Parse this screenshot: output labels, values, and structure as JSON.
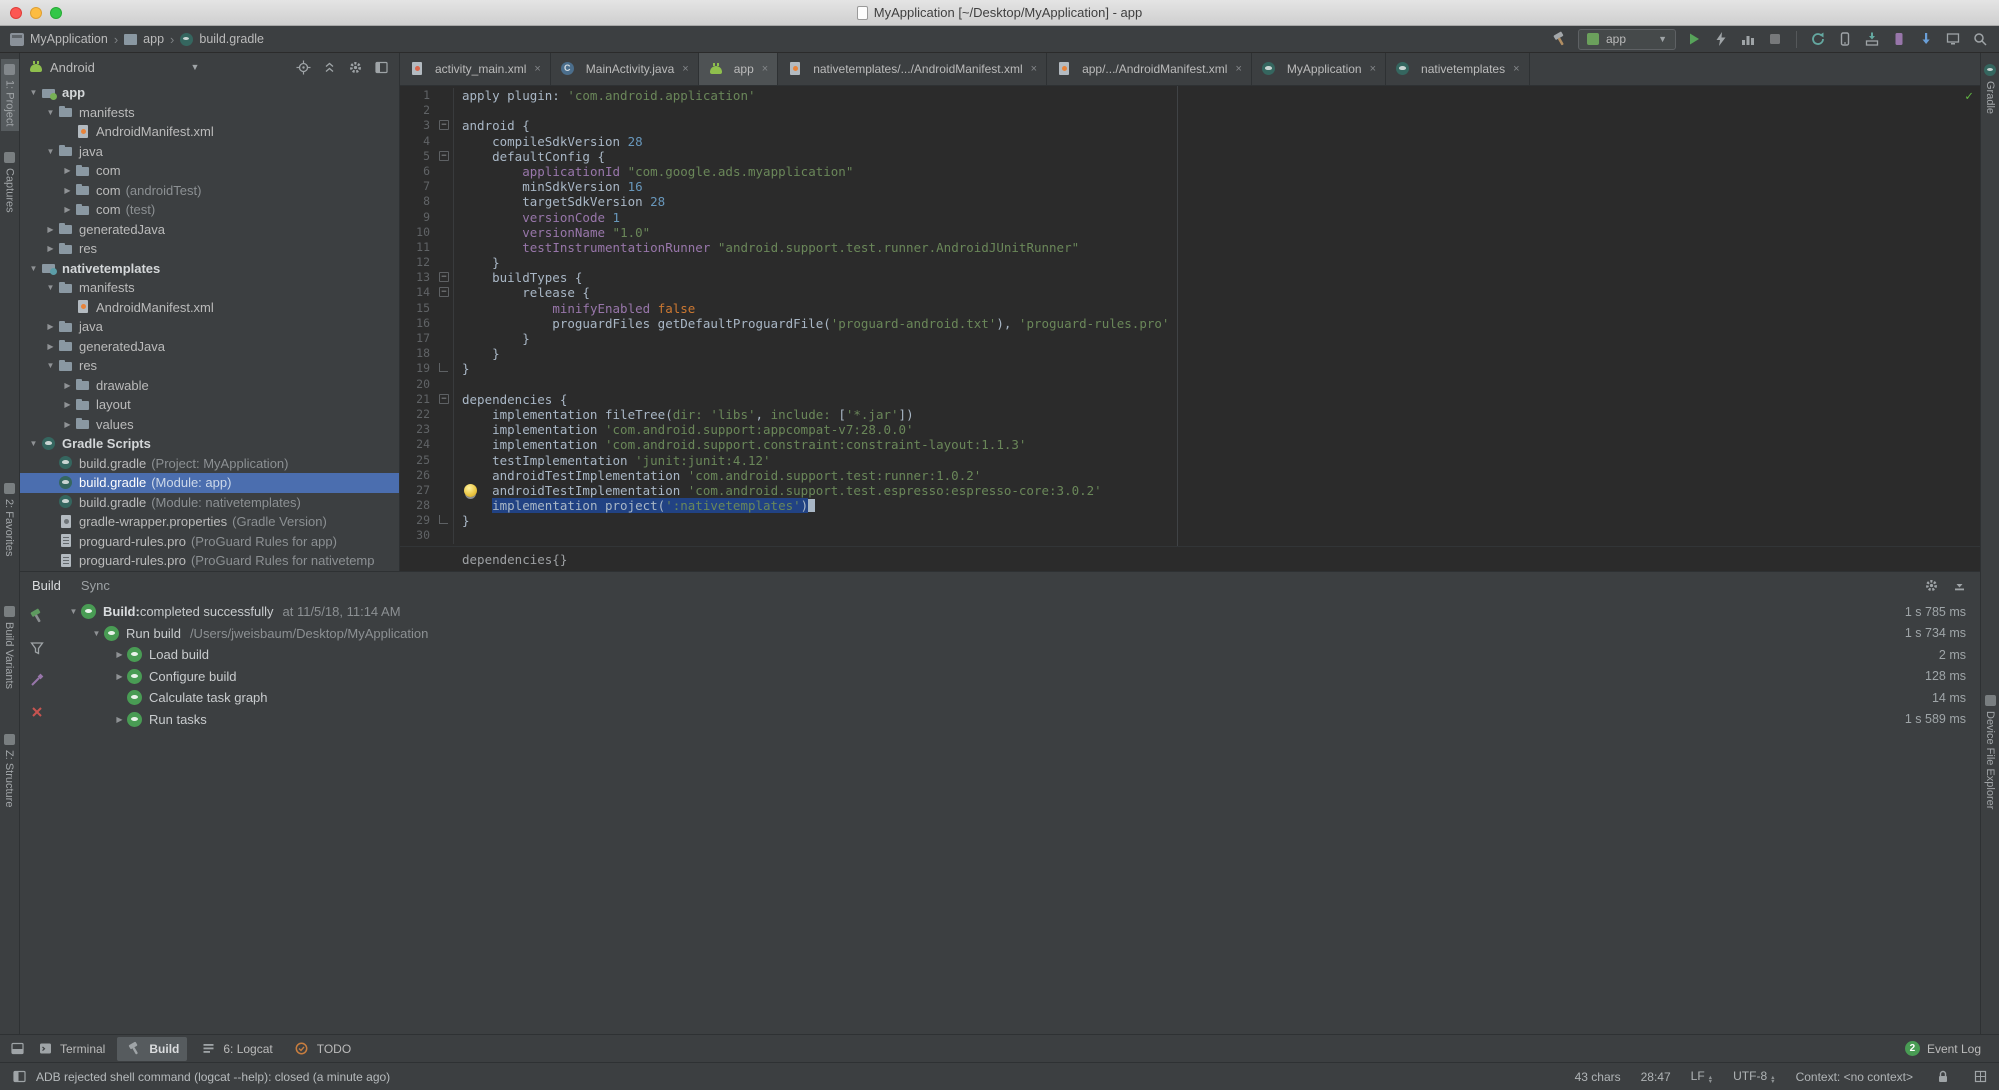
{
  "colors": {
    "editor_bg": "#2b2b2b",
    "panel_bg": "#3c3f41",
    "tree_selection": "#4b6eaf",
    "editor_selection": "#214283",
    "string_green": "#6a8759",
    "number_blue": "#6897bb",
    "keyword_orange": "#cc7832",
    "property_purple": "#9876aa",
    "run_green": "#499c54",
    "error_red": "#c75450"
  },
  "titlebar": {
    "title": "MyApplication [~/Desktop/MyApplication] - app"
  },
  "toolbar": {
    "breadcrumbs": [
      "MyApplication",
      "app",
      "build.gradle"
    ],
    "run_config": "app"
  },
  "left_stripe": {
    "items": [
      "1: Project",
      "Captures",
      "2: Favorites",
      "Build Variants",
      "Z: Structure"
    ]
  },
  "right_stripe": {
    "items": [
      "Gradle",
      "Device File Explorer"
    ]
  },
  "project_panel": {
    "view_selector": "Android",
    "tree": [
      {
        "level": 0,
        "arrow": "v",
        "icon": "module-app",
        "label": "app",
        "bold": true
      },
      {
        "level": 1,
        "arrow": "v",
        "icon": "folder",
        "label": "manifests"
      },
      {
        "level": 2,
        "arrow": "",
        "icon": "manifest",
        "label": "AndroidManifest.xml"
      },
      {
        "level": 1,
        "arrow": "v",
        "icon": "folder",
        "label": "java"
      },
      {
        "level": 2,
        "arrow": ">",
        "icon": "package",
        "label": "com"
      },
      {
        "level": 2,
        "arrow": ">",
        "icon": "package",
        "label": "com",
        "suffix": "(androidTest)"
      },
      {
        "level": 2,
        "arrow": ">",
        "icon": "package",
        "label": "com",
        "suffix": "(test)"
      },
      {
        "level": 1,
        "arrow": ">",
        "icon": "folder-gen",
        "label": "generatedJava"
      },
      {
        "level": 1,
        "arrow": ">",
        "icon": "folder-res",
        "label": "res"
      },
      {
        "level": 0,
        "arrow": "v",
        "icon": "module-lib",
        "label": "nativetemplates",
        "bold": true
      },
      {
        "level": 1,
        "arrow": "v",
        "icon": "folder",
        "label": "manifests"
      },
      {
        "level": 2,
        "arrow": "",
        "icon": "manifest",
        "label": "AndroidManifest.xml"
      },
      {
        "level": 1,
        "arrow": ">",
        "icon": "folder",
        "label": "java"
      },
      {
        "level": 1,
        "arrow": ">",
        "icon": "folder-gen",
        "label": "generatedJava"
      },
      {
        "level": 1,
        "arrow": "v",
        "icon": "folder-res",
        "label": "res"
      },
      {
        "level": 2,
        "arrow": ">",
        "icon": "folder",
        "label": "drawable"
      },
      {
        "level": 2,
        "arrow": ">",
        "icon": "folder",
        "label": "layout"
      },
      {
        "level": 2,
        "arrow": ">",
        "icon": "folder",
        "label": "values"
      },
      {
        "level": 0,
        "arrow": "v",
        "icon": "gradle",
        "label": "Gradle Scripts",
        "bold": true
      },
      {
        "level": 1,
        "arrow": "",
        "icon": "gradle-file",
        "label": "build.gradle",
        "suffix": "(Project: MyApplication)"
      },
      {
        "level": 1,
        "arrow": "",
        "icon": "gradle-file",
        "label": "build.gradle",
        "suffix": "(Module: app)",
        "selected": true
      },
      {
        "level": 1,
        "arrow": "",
        "icon": "gradle-file",
        "label": "build.gradle",
        "suffix": "(Module: nativetemplates)"
      },
      {
        "level": 1,
        "arrow": "",
        "icon": "wrapper",
        "label": "gradle-wrapper.properties",
        "suffix": "(Gradle Version)"
      },
      {
        "level": 1,
        "arrow": "",
        "icon": "proguard",
        "label": "proguard-rules.pro",
        "suffix": "(ProGuard Rules for app)"
      },
      {
        "level": 1,
        "arrow": "",
        "icon": "proguard",
        "label": "proguard-rules.pro",
        "suffix": "(ProGuard Rules for nativetemp"
      }
    ]
  },
  "tabs": [
    {
      "icon": "layout",
      "label": "activity_main.xml"
    },
    {
      "icon": "class",
      "label": "MainActivity.java"
    },
    {
      "icon": "android",
      "label": "app",
      "selected": true
    },
    {
      "icon": "manifest",
      "label": "nativetemplates/.../AndroidManifest.xml"
    },
    {
      "icon": "manifest",
      "label": "app/.../AndroidManifest.xml"
    },
    {
      "icon": "gradle",
      "label": "MyApplication"
    },
    {
      "icon": "gradle",
      "label": "nativetemplates"
    }
  ],
  "editor": {
    "caret_line": 28,
    "fold_lines": [
      3,
      5,
      13,
      14,
      21
    ],
    "fold_end_lines": [
      19,
      29
    ],
    "scope_breadcrumb": "dependencies{}",
    "lines": [
      [
        [
          "d",
          "apply plugin: "
        ],
        [
          "s",
          "'com.android.application'"
        ]
      ],
      [],
      [
        [
          "d",
          "android {"
        ]
      ],
      [
        [
          "d",
          "    compileSdkVersion "
        ],
        [
          "n",
          "28"
        ]
      ],
      [
        [
          "d",
          "    defaultConfig {"
        ]
      ],
      [
        [
          "d",
          "        "
        ],
        [
          "p",
          "applicationId"
        ],
        [
          "d",
          " "
        ],
        [
          "s",
          "\"com.google.ads.myapplication\""
        ]
      ],
      [
        [
          "d",
          "        minSdkVersion "
        ],
        [
          "n",
          "16"
        ]
      ],
      [
        [
          "d",
          "        targetSdkVersion "
        ],
        [
          "n",
          "28"
        ]
      ],
      [
        [
          "d",
          "        "
        ],
        [
          "p",
          "versionCode"
        ],
        [
          "d",
          " "
        ],
        [
          "n",
          "1"
        ]
      ],
      [
        [
          "d",
          "        "
        ],
        [
          "p",
          "versionName"
        ],
        [
          "d",
          " "
        ],
        [
          "s",
          "\"1.0\""
        ]
      ],
      [
        [
          "d",
          "        "
        ],
        [
          "p",
          "testInstrumentationRunner"
        ],
        [
          "d",
          " "
        ],
        [
          "s",
          "\"android.support.test.runner.AndroidJUnitRunner\""
        ]
      ],
      [
        [
          "d",
          "    }"
        ]
      ],
      [
        [
          "d",
          "    buildTypes {"
        ]
      ],
      [
        [
          "d",
          "        release {"
        ]
      ],
      [
        [
          "d",
          "            "
        ],
        [
          "p",
          "minifyEnabled"
        ],
        [
          "d",
          " "
        ],
        [
          "k",
          "false"
        ]
      ],
      [
        [
          "d",
          "            proguardFiles getDefaultProguardFile("
        ],
        [
          "s",
          "'proguard-android.txt'"
        ],
        [
          "d",
          "), "
        ],
        [
          "s",
          "'proguard-rules.pro'"
        ]
      ],
      [
        [
          "d",
          "        }"
        ]
      ],
      [
        [
          "d",
          "    }"
        ]
      ],
      [
        [
          "d",
          "}"
        ]
      ],
      [],
      [
        [
          "d",
          "dependencies {"
        ]
      ],
      [
        [
          "d",
          "    implementation fileTree("
        ],
        [
          "m",
          "dir:"
        ],
        [
          "d",
          " "
        ],
        [
          "s",
          "'libs'"
        ],
        [
          "d",
          ", "
        ],
        [
          "m",
          "include:"
        ],
        [
          "d",
          " ["
        ],
        [
          "s",
          "'*.jar'"
        ],
        [
          "d",
          "])"
        ]
      ],
      [
        [
          "d",
          "    implementation "
        ],
        [
          "s",
          "'com.android.support:appcompat-v7:28.0.0'"
        ]
      ],
      [
        [
          "d",
          "    implementation "
        ],
        [
          "s",
          "'com.android.support.constraint:constraint-layout:1.1.3'"
        ]
      ],
      [
        [
          "d",
          "    testImplementation "
        ],
        [
          "s",
          "'junit:junit:4.12'"
        ]
      ],
      [
        [
          "d",
          "    androidTestImplementation "
        ],
        [
          "s",
          "'com.android.support.test:runner:1.0.2'"
        ]
      ],
      [
        [
          "d",
          "    androidTestImplementation "
        ],
        [
          "s",
          "'com.android.support.test.espresso:espresso-core:3.0.2'"
        ]
      ],
      [
        [
          "d",
          "    "
        ],
        [
          "d",
          "implementation project(",
          1
        ],
        [
          "s",
          "':nativetemplates'",
          1
        ],
        [
          "d",
          ")",
          1
        ]
      ],
      [
        [
          "d",
          "}"
        ]
      ],
      []
    ]
  },
  "build_panel": {
    "tabs": [
      "Build",
      "Sync"
    ],
    "rows": [
      {
        "level": 0,
        "arrow": "v",
        "bold": "Build:",
        "label": " completed successfully",
        "meta": "at 11/5/18, 11:14 AM",
        "duration": "1 s 785 ms"
      },
      {
        "level": 1,
        "arrow": "v",
        "bold": "",
        "label": "Run build",
        "meta": "/Users/jweisbaum/Desktop/MyApplication",
        "duration": "1 s 734 ms"
      },
      {
        "level": 2,
        "arrow": ">",
        "bold": "",
        "label": "Load build",
        "meta": "",
        "duration": "2 ms"
      },
      {
        "level": 2,
        "arrow": ">",
        "bold": "",
        "label": "Configure build",
        "meta": "",
        "duration": "128 ms"
      },
      {
        "level": 2,
        "arrow": "",
        "bold": "",
        "label": "Calculate task graph",
        "meta": "",
        "duration": "14 ms"
      },
      {
        "level": 2,
        "arrow": ">",
        "bold": "",
        "label": "Run tasks",
        "meta": "",
        "duration": "1 s 589 ms"
      }
    ]
  },
  "bottom_bar": {
    "items": [
      {
        "icon": "terminal",
        "label": "Terminal"
      },
      {
        "icon": "build",
        "label": "Build",
        "selected": true
      },
      {
        "icon": "logcat",
        "label": "6: Logcat"
      },
      {
        "icon": "todo",
        "label": "TODO"
      }
    ],
    "event_log_count": "2",
    "event_log_label": "Event Log"
  },
  "status_bar": {
    "message": "ADB rejected shell command (logcat --help): closed (a minute ago)",
    "chars": "43 chars",
    "caret_position": "28:47",
    "line_separator": "LF",
    "encoding": "UTF-8",
    "context": "Context: <no context>"
  }
}
